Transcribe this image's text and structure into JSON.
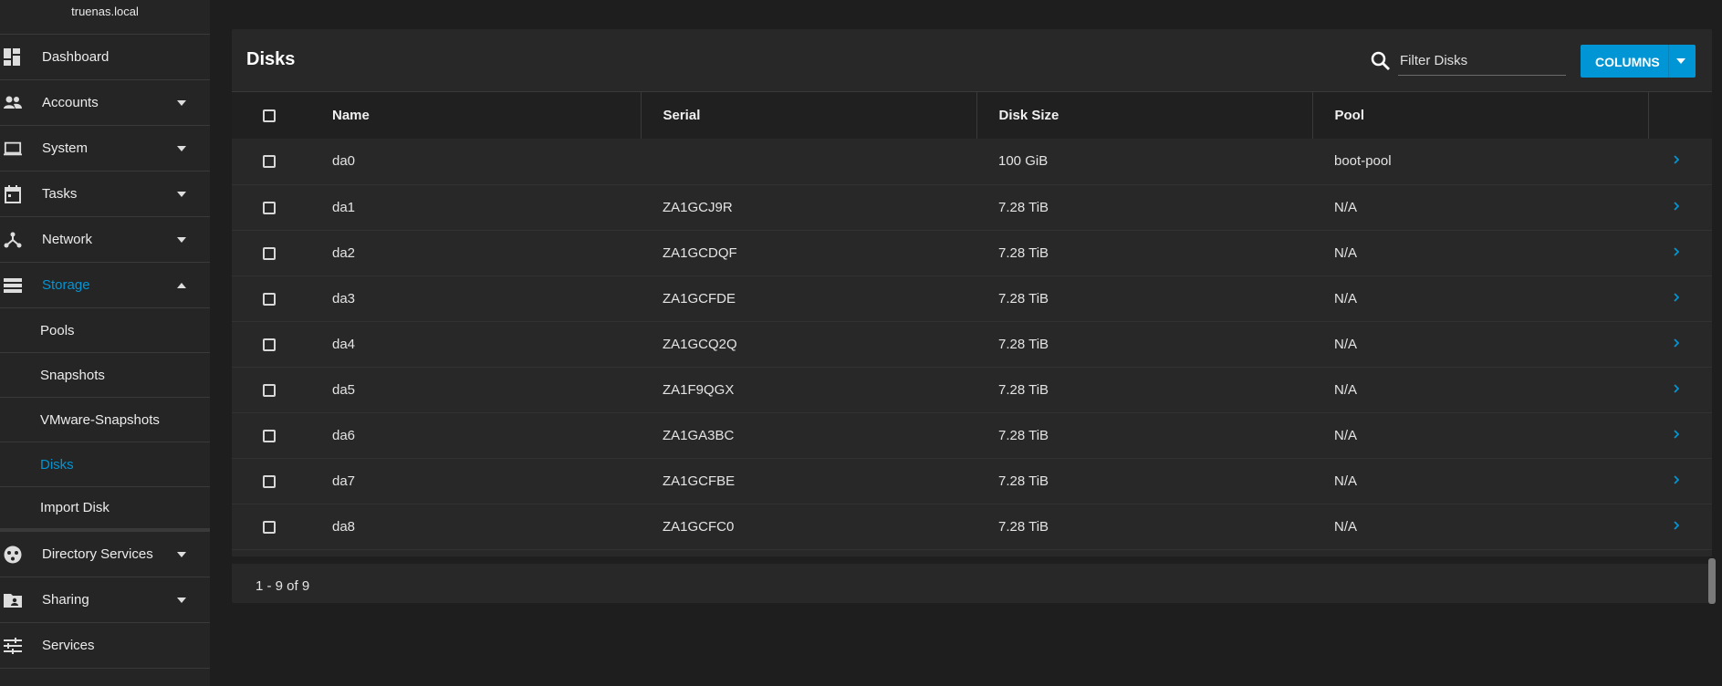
{
  "sidebar": {
    "hostname": "truenas.local",
    "items": [
      {
        "label": "Dashboard",
        "icon": "dashboard-icon"
      },
      {
        "label": "Accounts",
        "icon": "people-icon"
      },
      {
        "label": "System",
        "icon": "laptop-icon"
      },
      {
        "label": "Tasks",
        "icon": "calendar-icon"
      },
      {
        "label": "Network",
        "icon": "network-icon"
      },
      {
        "label": "Storage",
        "icon": "storage-icon"
      }
    ],
    "storage_subitems": [
      {
        "label": "Pools"
      },
      {
        "label": "Snapshots"
      },
      {
        "label": "VMware-Snapshots"
      },
      {
        "label": "Disks"
      },
      {
        "label": "Import Disk"
      }
    ],
    "items_after": [
      {
        "label": "Directory Services",
        "icon": "directory-icon"
      },
      {
        "label": "Sharing",
        "icon": "sharing-icon"
      },
      {
        "label": "Services",
        "icon": "services-icon"
      }
    ],
    "accent_color": "#0095d5"
  },
  "disks": {
    "title": "Disks",
    "filter_placeholder": "Filter Disks",
    "columns_button": "COLUMNS",
    "headers": [
      "Name",
      "Serial",
      "Disk Size",
      "Pool"
    ],
    "rows": [
      {
        "name": "da0",
        "serial": "",
        "size": "100 GiB",
        "pool": "boot-pool"
      },
      {
        "name": "da1",
        "serial": "ZA1GCJ9R",
        "size": "7.28 TiB",
        "pool": "N/A"
      },
      {
        "name": "da2",
        "serial": "ZA1GCDQF",
        "size": "7.28 TiB",
        "pool": "N/A"
      },
      {
        "name": "da3",
        "serial": "ZA1GCFDE",
        "size": "7.28 TiB",
        "pool": "N/A"
      },
      {
        "name": "da4",
        "serial": "ZA1GCQ2Q",
        "size": "7.28 TiB",
        "pool": "N/A"
      },
      {
        "name": "da5",
        "serial": "ZA1F9QGX",
        "size": "7.28 TiB",
        "pool": "N/A"
      },
      {
        "name": "da6",
        "serial": "ZA1GA3BC",
        "size": "7.28 TiB",
        "pool": "N/A"
      },
      {
        "name": "da7",
        "serial": "ZA1GCFBE",
        "size": "7.28 TiB",
        "pool": "N/A"
      },
      {
        "name": "da8",
        "serial": "ZA1GCFC0",
        "size": "7.28 TiB",
        "pool": "N/A"
      }
    ],
    "pagination": "1 - 9 of 9"
  }
}
